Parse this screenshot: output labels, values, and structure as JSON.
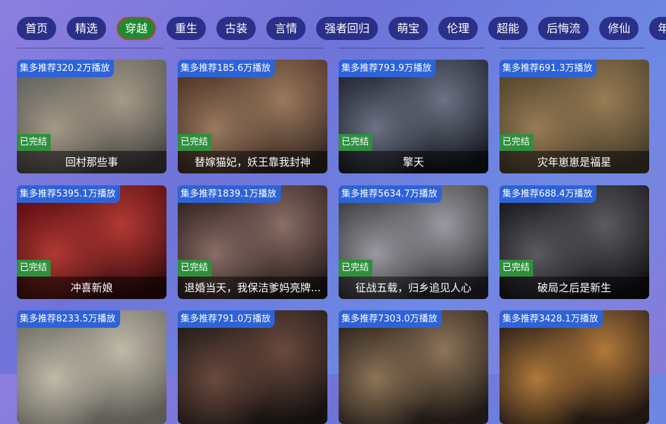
{
  "tabs": [
    {
      "label": "首页",
      "active": false
    },
    {
      "label": "精选",
      "active": false
    },
    {
      "label": "穿越",
      "active": true
    },
    {
      "label": "重生",
      "active": false
    },
    {
      "label": "古装",
      "active": false
    },
    {
      "label": "言情",
      "active": false
    },
    {
      "label": "强者回归",
      "active": false
    },
    {
      "label": "萌宝",
      "active": false
    },
    {
      "label": "伦理",
      "active": false
    },
    {
      "label": "超能",
      "active": false
    },
    {
      "label": "后悔流",
      "active": false
    },
    {
      "label": "修仙",
      "active": false
    },
    {
      "label": "年",
      "active": false
    }
  ],
  "cards": [
    {
      "tag": "集多推荐320.2万播放",
      "status": "已完结",
      "title": "回村那些事",
      "colors": [
        "#6b6d6a",
        "#a69a86",
        "#3c3b39"
      ]
    },
    {
      "tag": "集多推荐185.6万播放",
      "status": "已完结",
      "title": "替嫁猫妃，妖王靠我封神",
      "colors": [
        "#5b3b2a",
        "#9b7a5e",
        "#2c2420"
      ]
    },
    {
      "tag": "集多推荐793.9万播放",
      "status": "已完结",
      "title": "擎天",
      "colors": [
        "#2a2e3c",
        "#6c7384",
        "#111318"
      ]
    },
    {
      "tag": "集多推荐691.3万播放",
      "status": "已完结",
      "title": "灾年崽崽是福星",
      "colors": [
        "#5a4a2f",
        "#9a7c55",
        "#3e3a29"
      ]
    },
    {
      "tag": "集多推荐5395.1万播放",
      "status": "已完结",
      "title": "冲喜新娘",
      "colors": [
        "#6a0f14",
        "#b23a34",
        "#2a0a0c"
      ]
    },
    {
      "tag": "集多推荐1839.1万播放",
      "status": "已完结",
      "title": "退婚当天，我保洁爹妈亮牌...",
      "colors": [
        "#3c2a26",
        "#8a6d66",
        "#1e1716"
      ]
    },
    {
      "tag": "集多推荐5634.7万播放",
      "status": "已完结",
      "title": "征战五载，归乡追见人心",
      "colors": [
        "#4a4a4e",
        "#9b9aa1",
        "#222226"
      ]
    },
    {
      "tag": "集多推荐688.4万播放",
      "status": "已完结",
      "title": "破局之后是新生",
      "colors": [
        "#1e1e22",
        "#5d5b60",
        "#0e0e12"
      ]
    },
    {
      "tag": "集多推荐8233.5万播放",
      "status": "",
      "title": "",
      "colors": [
        "#7c7a73",
        "#c0b9a8",
        "#5a5852"
      ]
    },
    {
      "tag": "集多推荐791.0万播放",
      "status": "",
      "title": "",
      "colors": [
        "#2b2220",
        "#6b4a3d",
        "#141010"
      ]
    },
    {
      "tag": "集多推荐7303.0万播放",
      "status": "",
      "title": "",
      "colors": [
        "#3a2e26",
        "#8d7457",
        "#1c1714"
      ]
    },
    {
      "tag": "集多推荐3428.1万播放",
      "status": "",
      "title": "",
      "colors": [
        "#3b2a1e",
        "#b17a3a",
        "#1d1510"
      ]
    }
  ]
}
